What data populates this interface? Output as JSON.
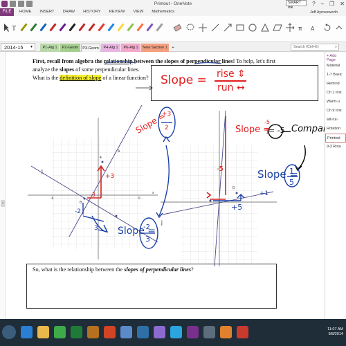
{
  "window": {
    "title": "Printout - OneNote",
    "smart_ink": "SMART Ink",
    "controls": [
      "?",
      "–",
      "❐",
      "✕"
    ]
  },
  "ribbon": {
    "file": "FILE",
    "tabs": [
      "HOME",
      "INSERT",
      "DRAW",
      "HISTORY",
      "REVIEW",
      "VIEW",
      "Mathematics"
    ],
    "user": "Jeff Aymesworth"
  },
  "toolbar": {
    "pen_colors": [
      "#9b9b00",
      "#2e7d32",
      "#1565c0",
      "#c62828",
      "#6a1b9a",
      "#212121",
      "#c62828",
      "#c62828",
      "#e53935",
      "#1e88e5",
      "#fdd835",
      "#8bc34a",
      "#ff7043",
      "#7e57c2",
      "#9e9e9e"
    ]
  },
  "notebook": {
    "name": "2014-15",
    "sections": [
      {
        "label": "P1-Alg 1",
        "color": "#b9d9a8"
      },
      {
        "label": "P2-Geom",
        "color": "#a6cf8e"
      },
      {
        "label": "P3-Geom",
        "color": "#f4f4f4"
      },
      {
        "label": "P4-Alg 1",
        "color": "#e8b4e0"
      },
      {
        "label": "P6-Alg 1",
        "color": "#f2a8c8"
      },
      {
        "label": "New Section 1",
        "color": "#f4a080"
      }
    ],
    "add_section": "+",
    "search_placeholder": "Search (Ctrl+E)"
  },
  "content": {
    "intro_line1_pre": "First, recall from algebra the ",
    "intro_line1_bold": "relationship",
    "intro_line1_mid": " between the slopes of perpendicular lines!",
    "intro_line1_post": " To help, let's first",
    "intro_line2_pre": "analyze the ",
    "intro_line2_bold": "slopes",
    "intro_line2_post": " of some perpendicular lines.",
    "intro_line3_pre": "What is the ",
    "intro_line3_hl": "definition of slope",
    "intro_line3_post": " of a linear function?",
    "question_pre": "So, what is the relationship between the ",
    "question_italic": "slopes of perpendicular lines",
    "question_post": "?"
  },
  "ink": {
    "definition": "Slope =",
    "rise": "rise",
    "run": "run",
    "plus3": "+3",
    "minus3": "-3",
    "minus2": "-2",
    "slope_left": "Slope =",
    "frac_top_left": "+3",
    "frac_bot_left": "2",
    "slope_bottom": "Slope =",
    "frac_top_bottom": "-2",
    "frac_bot_bottom": "3",
    "slope_right": "Slope =",
    "slope_right_frac": "-5",
    "slope_right_den": "1",
    "slope_right_val": "= -5",
    "compare": "Compare",
    "plus5": "+5",
    "plus1": "+1",
    "minus5": "-5",
    "slope_right2": "Slope =",
    "frac_top_right": "1",
    "frac_bot_right": "5"
  },
  "graph_labels": {
    "left_j": "j",
    "right_j": "j",
    "x_label": "x",
    "a_label": "A",
    "b_label": "B",
    "d_label": "D",
    "x_tick_left": "-6",
    "x_tick_right": "6",
    "y_tick": "4"
  },
  "pages": {
    "add_page": "+ Add Page",
    "items": [
      "Material",
      "1-7 Basic",
      "Remind",
      "Ch 1 Inst",
      "Warm-u",
      "Ch 9 Inst",
      "wit-rut-",
      "Rotation",
      "Printout",
      "9-3 Rota"
    ],
    "active_index": 8
  },
  "taskbar": {
    "time": "11:07 AM",
    "date": "9/8/2014",
    "apps": [
      {
        "name": "ie-icon",
        "color": "#2a7fd4"
      },
      {
        "name": "folder-icon",
        "color": "#e8b84a"
      },
      {
        "name": "chrome-icon",
        "color": "#3cab48"
      },
      {
        "name": "excel-icon",
        "color": "#1f7a3a"
      },
      {
        "name": "gallery-icon",
        "color": "#b6701f"
      },
      {
        "name": "powerpoint-icon",
        "color": "#d14424"
      },
      {
        "name": "notebook-icon",
        "color": "#5a8ac9"
      },
      {
        "name": "ruler-icon",
        "color": "#2f6fa8"
      },
      {
        "name": "paint-icon",
        "color": "#8c6bd1"
      },
      {
        "name": "skype-icon",
        "color": "#2aa5e0"
      },
      {
        "name": "onenote-icon",
        "color": "#7a2f8c"
      },
      {
        "name": "camera-icon",
        "color": "#5c6d7d"
      },
      {
        "name": "firefox-icon",
        "color": "#e0812d"
      },
      {
        "name": "smart-icon",
        "color": "#c93a2e"
      }
    ]
  }
}
